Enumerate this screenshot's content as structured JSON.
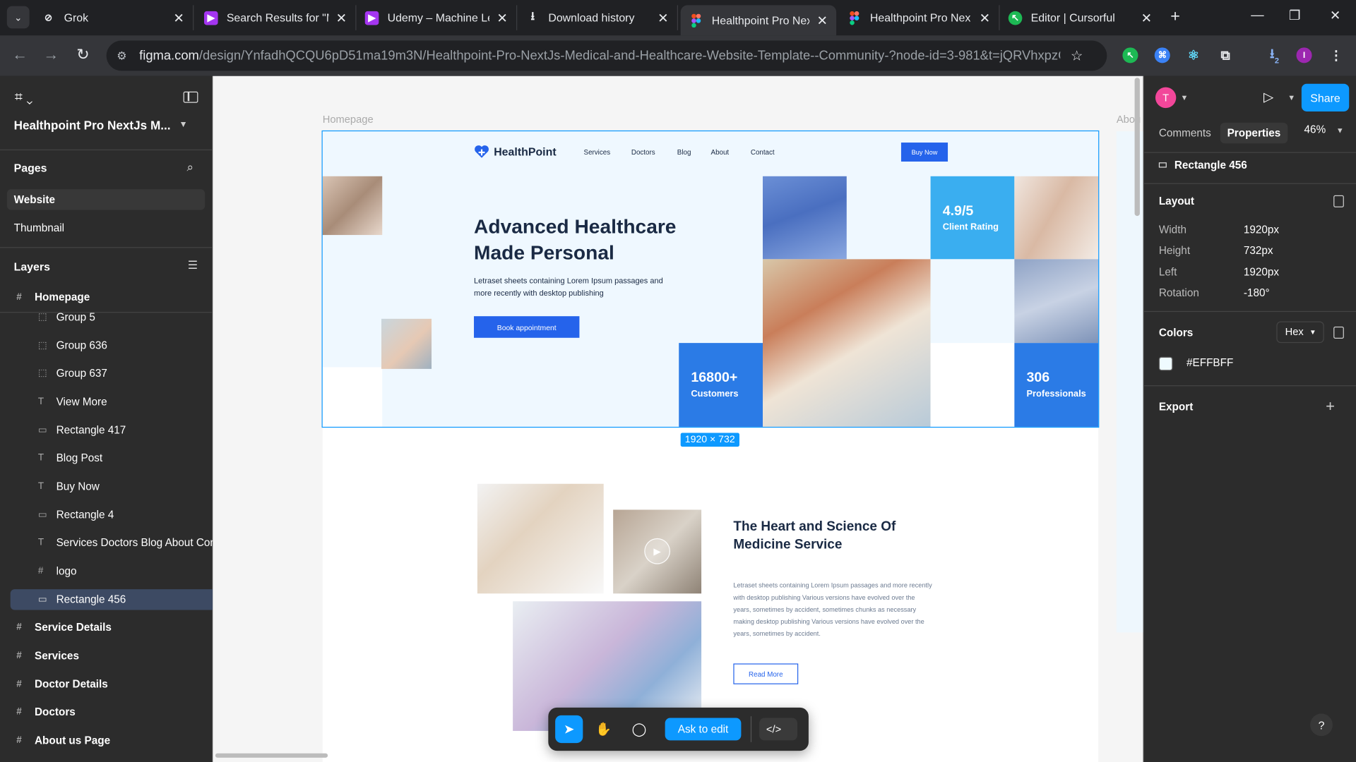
{
  "browser": {
    "tabs": [
      {
        "label": "Grok",
        "color": "#444444",
        "icon": "grok-icon"
      },
      {
        "label": "Search Results for \"M",
        "color": "#a435f0",
        "icon": "udemy-icon"
      },
      {
        "label": "Udemy – Machine Le",
        "color": "#a435f0",
        "icon": "udemy-icon"
      },
      {
        "label": "Download history",
        "color": "#202124",
        "icon": "download-icon"
      },
      {
        "label": "Healthpoint Pro Next",
        "color": "#f24e1e",
        "icon": "figma-icon"
      },
      {
        "label": "Healthpoint Pro Nex",
        "color": "#f24e1e",
        "icon": "figma-icon"
      },
      {
        "label": "Editor | Cursorful",
        "color": "#1db954",
        "icon": "cursorful-icon"
      }
    ],
    "url_host": "figma.com",
    "url_path": "/design/YnfadhQCQU6pD51ma19m3N/Healthpoint-Pro-NextJs-Medical-and-Healthcare-Website-Template--Community-?node-id=3-981&t=jQRVhxpzCHyl7...",
    "profile_initial": "I",
    "download_count": "2"
  },
  "figma": {
    "file_name": "Healthpoint Pro NextJs M...",
    "pages_heading": "Pages",
    "pages": [
      "Website",
      "Thumbnail"
    ],
    "layers_heading": "Layers",
    "layers": [
      {
        "name": "Homepage",
        "type": "frame"
      },
      {
        "name": "Group 5",
        "type": "group"
      },
      {
        "name": "Group 636",
        "type": "group"
      },
      {
        "name": "Group 637",
        "type": "group"
      },
      {
        "name": "View More",
        "type": "text"
      },
      {
        "name": "Rectangle 417",
        "type": "rect"
      },
      {
        "name": "Blog Post",
        "type": "text"
      },
      {
        "name": "Buy Now",
        "type": "text"
      },
      {
        "name": "Rectangle 4",
        "type": "rect"
      },
      {
        "name": "Services Doctors Blog About Con",
        "type": "text"
      },
      {
        "name": "logo",
        "type": "frame"
      },
      {
        "name": "Rectangle 456",
        "type": "rect"
      },
      {
        "name": "Service Details",
        "type": "frame"
      },
      {
        "name": "Services",
        "type": "frame"
      },
      {
        "name": "Doctor Details",
        "type": "frame"
      },
      {
        "name": "Doctors",
        "type": "frame"
      },
      {
        "name": "About us Page",
        "type": "frame"
      }
    ],
    "canvas": {
      "frame_label": "Homepage",
      "frame_label_right": "Abou",
      "dimension_badge": "1920 × 732"
    },
    "toolbar": {
      "ask_label": "Ask to edit"
    },
    "right": {
      "avatar_initial": "T",
      "share_label": "Share",
      "tab_comments": "Comments",
      "tab_properties": "Properties",
      "zoom": "46%",
      "selection_name": "Rectangle 456",
      "layout_heading": "Layout",
      "props": [
        {
          "label": "Width",
          "value": "1920px"
        },
        {
          "label": "Height",
          "value": "732px"
        },
        {
          "label": "Left",
          "value": "1920px"
        },
        {
          "label": "Rotation",
          "value": "-180°"
        }
      ],
      "colors_heading": "Colors",
      "color_format": "Hex",
      "color_value": "#EFFBFF",
      "export_heading": "Export",
      "help": "?"
    }
  },
  "site": {
    "logo_name": "HealthPoint",
    "nav": [
      "Services",
      "Doctors",
      "Blog",
      "About",
      "Contact"
    ],
    "buy_now": "Buy Now",
    "hero_title": "Advanced Healthcare Made Personal",
    "hero_desc": "Letraset sheets containing Lorem Ipsum passages and more recently with desktop publishing",
    "book_label": "Book appointment",
    "stats": [
      {
        "value": "4.9/5",
        "label": "Client Rating"
      },
      {
        "value": "16800+",
        "label": "Customers"
      },
      {
        "value": "306",
        "label": "Professionals"
      }
    ],
    "sec2_title": "The Heart and Science Of Medicine Service",
    "sec2_desc": "Letraset sheets containing Lorem Ipsum passages and more recently with desktop publishing Various versions have evolved over the years, sometimes by accident, sometimes chunks as necessary making desktop publishing Various versions have evolved over the years, sometimes by accident.",
    "read_more": "Read More"
  },
  "colors": {
    "figma_blue": "#0d99ff",
    "site_blue": "#2563eb",
    "hero_bg": "#eff8ff",
    "panel_bg": "#2c2c2c"
  }
}
